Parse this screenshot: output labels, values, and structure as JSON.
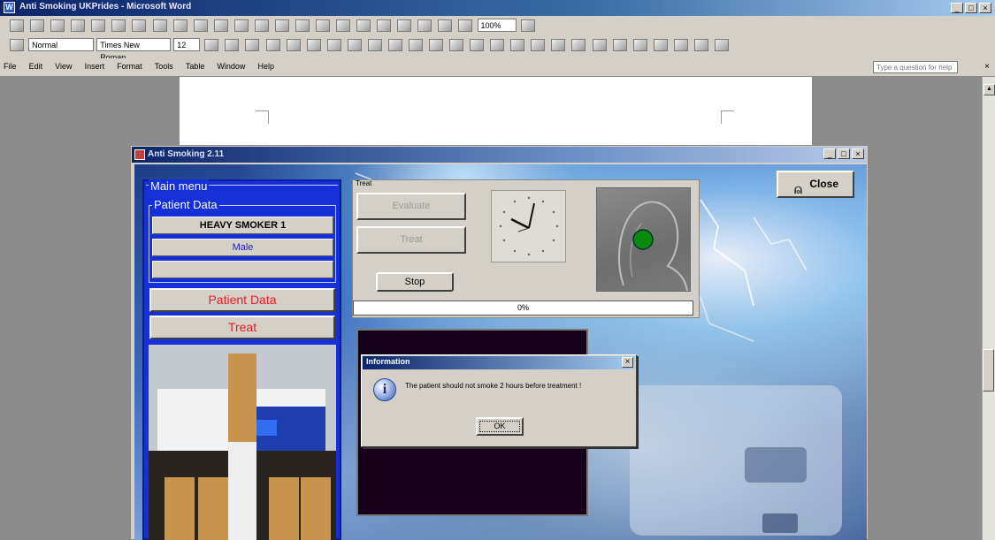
{
  "word": {
    "title": "Anti Smoking UKPrides - Microsoft Word",
    "window_controls": [
      "_",
      "□",
      "×"
    ],
    "zoom": "100%",
    "style_box": "Normal",
    "font_box": "Times New Roman",
    "size_box": "12",
    "menu": [
      "File",
      "Edit",
      "View",
      "Insert",
      "Format",
      "Tools",
      "Table",
      "Window",
      "Help"
    ],
    "ask_placeholder": "Type a question for help"
  },
  "app": {
    "title": "Anti Smoking 2.11",
    "window_controls": [
      "_",
      "□",
      "×"
    ],
    "close_label": "Close",
    "main_menu_label": "Main menu",
    "patient_group_label": "Patient Data",
    "patient_name": "HEAVY SMOKER 1",
    "patient_gender": "Male",
    "patient_extra": "",
    "patient_data_button": "Patient Data",
    "treat_button": "Treat",
    "treat_panel": {
      "label": "Treat",
      "evaluate_label": "Evaluate",
      "treat_label": "Treat",
      "stop_label": "Stop",
      "progress_text": "0%",
      "progress_value": 0,
      "status_color": "#0a8a0a"
    }
  },
  "dialog": {
    "title": "Information",
    "message": "The patient should not smoke 2 hours before treatment !",
    "ok_label": "OK",
    "close_symbol": "×"
  },
  "colors": {
    "title_bar": "#0a246a",
    "menu_panel": "#1530d8",
    "red_text": "#e02020",
    "face": "#d4d0c8"
  }
}
